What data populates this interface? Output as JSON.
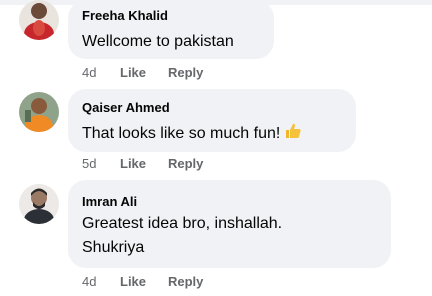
{
  "comments": [
    {
      "author": "Freeha Khalid",
      "text_lines": [
        "Wellcome to pakistan"
      ],
      "time": "4d",
      "like_label": "Like",
      "reply_label": "Reply"
    },
    {
      "author": "Qaiser Ahmed",
      "text_lines": [
        "That looks like so much fun!"
      ],
      "emoji": "thumbs-up-icon",
      "time": "5d",
      "like_label": "Like",
      "reply_label": "Reply"
    },
    {
      "author": "Imran Ali",
      "text_lines": [
        "Greatest idea bro, inshallah.",
        "Shukriya"
      ],
      "time": "4d",
      "like_label": "Like",
      "reply_label": "Reply"
    }
  ],
  "colors": {
    "bubble": "#f0f2f5",
    "text": "#050505",
    "secondary": "#65676b"
  }
}
